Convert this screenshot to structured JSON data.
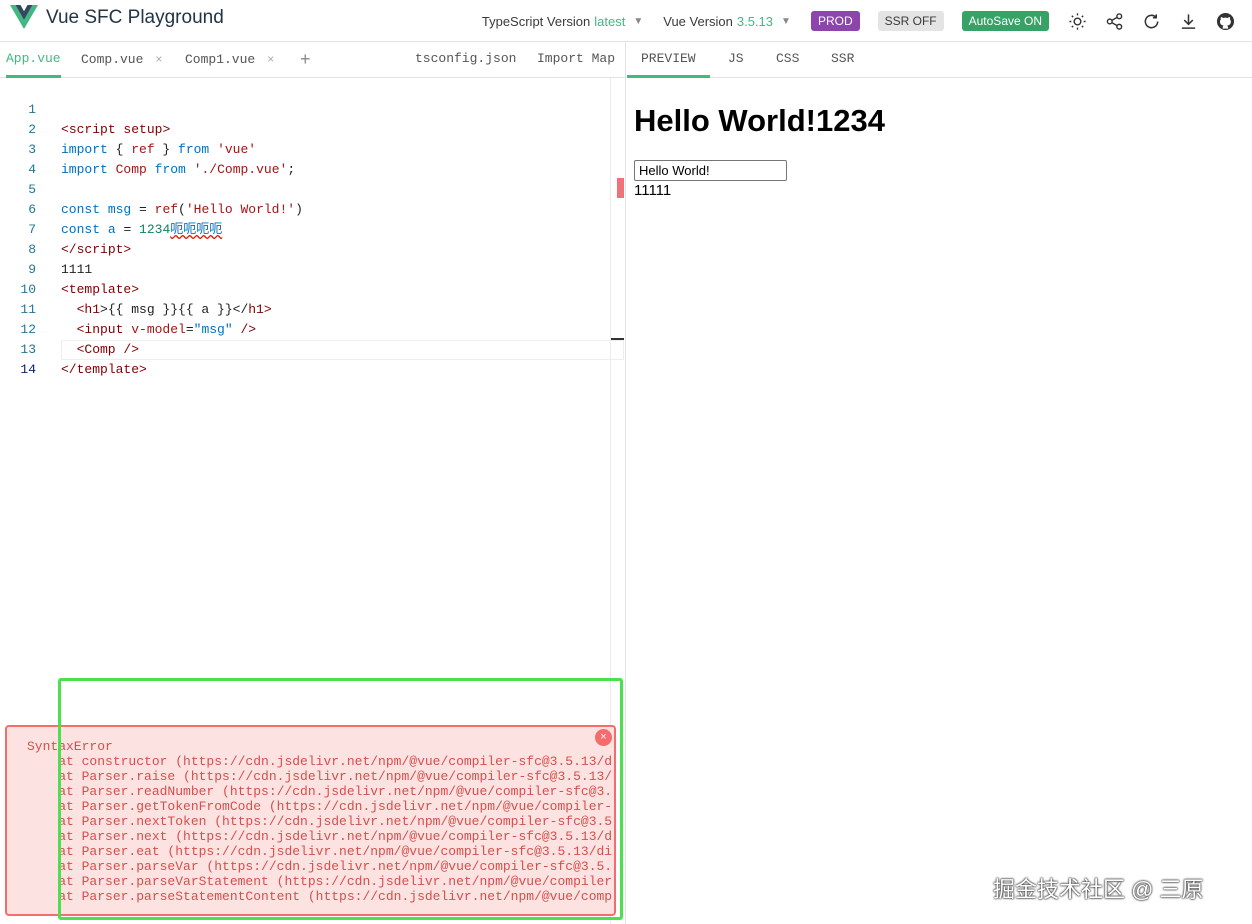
{
  "header": {
    "title": "Vue SFC Playground",
    "ts_label": "TypeScript Version",
    "ts_value": "latest",
    "vue_label": "Vue Version",
    "vue_value": "3.5.13",
    "prod_label": "PROD",
    "ssr_label": "SSR OFF",
    "autosave_label": "AutoSave ON",
    "icons": [
      "theme-toggle-icon",
      "share-icon",
      "reload-icon",
      "download-icon",
      "github-icon"
    ],
    "colors": {
      "accent": "#42b883",
      "prod": "#8e44ad",
      "autosave": "#37a266"
    }
  },
  "editor_tabs": {
    "app": "App.vue",
    "comp": "Comp.vue",
    "comp1": "Comp1.vue",
    "add": "+",
    "tsconfig": "tsconfig.json",
    "importmap": "Import Map",
    "close": "×"
  },
  "code": {
    "line_numbers": [
      "1",
      "2",
      "3",
      "4",
      "5",
      "6",
      "7",
      "8",
      "9",
      "10",
      "11",
      "12",
      "13",
      "14"
    ],
    "l1": [
      "<",
      "script",
      " setup",
      ">"
    ],
    "l2": [
      "import",
      " { ",
      "ref",
      " } ",
      "from",
      " ",
      "'vue'"
    ],
    "l3": [
      "import",
      " ",
      "Comp",
      " ",
      "from",
      " ",
      "'./Comp.vue'",
      ";"
    ],
    "l5": [
      "const",
      " ",
      "msg",
      " = ",
      "ref",
      "(",
      "'Hello World!'",
      ")"
    ],
    "l6": [
      "const",
      " ",
      "a",
      " = ",
      "1234",
      "呃呃呃呃"
    ],
    "l7": [
      "</",
      "script",
      ">"
    ],
    "l8": "1111",
    "l9": [
      "<",
      "template",
      ">"
    ],
    "l10": [
      "  <",
      "h1",
      ">{{ msg }}{{ a }}</",
      "h1",
      ">"
    ],
    "l11": [
      "  <",
      "input",
      " v-model",
      "=",
      "\"msg\"",
      " />"
    ],
    "l12": [
      "  <",
      "Comp",
      " />"
    ],
    "l13": [
      "</",
      "template",
      ">"
    ]
  },
  "error": {
    "close": "×",
    "text": "SyntaxError\n    at constructor (https://cdn.jsdelivr.net/npm/@vue/compiler-sfc@3.5.13/d\n    at Parser.raise (https://cdn.jsdelivr.net/npm/@vue/compiler-sfc@3.5.13/(\n    at Parser.readNumber (https://cdn.jsdelivr.net/npm/@vue/compiler-sfc@3.\n    at Parser.getTokenFromCode (https://cdn.jsdelivr.net/npm/@vue/compiler-\n    at Parser.nextToken (https://cdn.jsdelivr.net/npm/@vue/compiler-sfc@3.5\n    at Parser.next (https://cdn.jsdelivr.net/npm/@vue/compiler-sfc@3.5.13/d\n    at Parser.eat (https://cdn.jsdelivr.net/npm/@vue/compiler-sfc@3.5.13/di\n    at Parser.parseVar (https://cdn.jsdelivr.net/npm/@vue/compiler-sfc@3.5.\n    at Parser.parseVarStatement (https://cdn.jsdelivr.net/npm/@vue/compiler\n    at Parser.parseStatementContent (https://cdn.jsdelivr.net/npm/@vue/comp"
  },
  "output_tabs": {
    "preview": "PREVIEW",
    "js": "JS",
    "css": "CSS",
    "ssr": "SSR"
  },
  "preview": {
    "heading": "Hello World!1234",
    "input_value": "Hello World!",
    "text": "11111"
  },
  "watermark": "掘金技术社区 @ 三原"
}
